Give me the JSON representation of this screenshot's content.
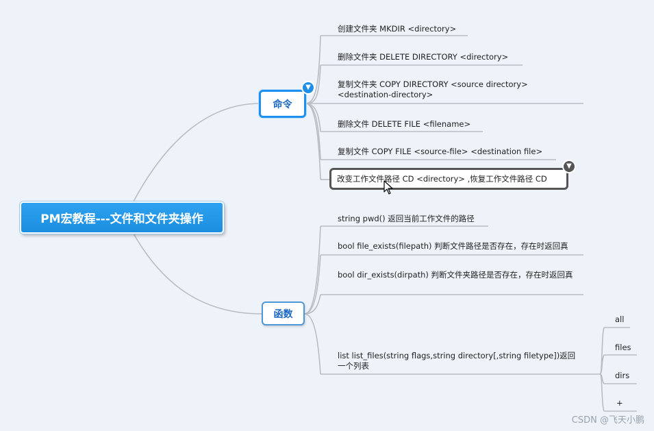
{
  "root": {
    "label": "PM宏教程---文件和文件夹操作"
  },
  "branches": {
    "commands": {
      "label": "命令",
      "items": [
        "创建文件夹 MKDIR <directory>",
        "删除文件夹 DELETE DIRECTORY <directory>",
        "复制文件夹 COPY DIRECTORY <source directory> <destination-directory>",
        "删除文件 DELETE FILE <filename>",
        "复制文件 COPY FILE <source-file> <destination file>",
        "改变工作文件路径 CD <directory>    ,恢复工作文件路径 CD"
      ]
    },
    "functions": {
      "label": "函数",
      "items": [
        "string pwd() 返回当前工作文件的路径",
        "bool file_exists(filepath) 判断文件路径是否存在，存在时返回真",
        "bool dir_exists(dirpath) 判断文件夹路径是否存在，存在时返回真",
        "list list_files(string flags,string directory[,string filetype])返回一个列表"
      ],
      "list_files_flags": [
        "all",
        "files",
        "dirs",
        "+"
      ]
    }
  },
  "watermark": "CSDN @飞天小鹏",
  "colors": {
    "background": "#eef3fa",
    "root_fill": "#1c8ee0",
    "topic_border": "#1e90f0",
    "line": "#b8bcc4"
  }
}
